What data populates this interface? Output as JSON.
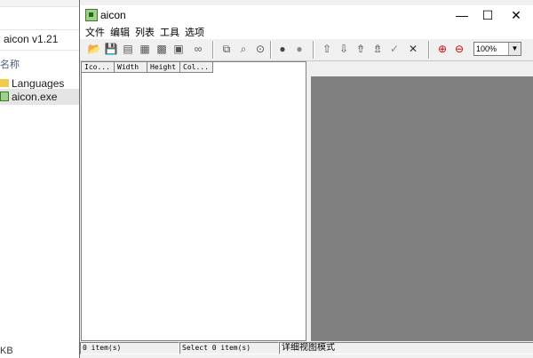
{
  "explorer": {
    "title": "aicon v1.21",
    "column_name": "名称",
    "items": [
      {
        "label": "Languages",
        "icon": "folder-icon"
      },
      {
        "label": "aicon.exe",
        "icon": "exe-icon",
        "selected": true
      }
    ],
    "size_text": "KB"
  },
  "window": {
    "title": "aicon",
    "controls": {
      "minimize": "—",
      "maximize": "☐",
      "close": "✕"
    }
  },
  "menu": {
    "items": [
      "文件",
      "编辑",
      "列表",
      "工具",
      "选项"
    ]
  },
  "toolbar": {
    "zoom": "100%",
    "buttons": [
      {
        "name": "open-icon",
        "glyph": "📂"
      },
      {
        "name": "save-icon",
        "glyph": "💾"
      },
      {
        "name": "save-all-icon",
        "glyph": "▤"
      },
      {
        "name": "export-icon",
        "glyph": "▦"
      },
      {
        "name": "export-all-icon",
        "glyph": "▩"
      },
      {
        "name": "extract-icon",
        "glyph": "▣"
      },
      {
        "name": "link-icon",
        "glyph": "∞"
      },
      {
        "name": "copy-icon",
        "glyph": "⧉"
      },
      {
        "name": "find-icon",
        "glyph": "⌕"
      },
      {
        "name": "search-icon",
        "glyph": "⊙"
      },
      {
        "name": "user-icon",
        "glyph": "●"
      },
      {
        "name": "user-grey-icon",
        "glyph": "●"
      },
      {
        "name": "arrow-up-icon",
        "glyph": "⇧"
      },
      {
        "name": "arrow-down-icon",
        "glyph": "⇩"
      },
      {
        "name": "move-top-icon",
        "glyph": "⇮"
      },
      {
        "name": "move-bottom-icon",
        "glyph": "⇯"
      },
      {
        "name": "check-icon",
        "glyph": "✓"
      },
      {
        "name": "delete-icon",
        "glyph": "✕"
      },
      {
        "name": "zoom-in-icon",
        "glyph": "⊕"
      },
      {
        "name": "zoom-out-icon",
        "glyph": "⊖"
      }
    ]
  },
  "list": {
    "columns": [
      "Ico...",
      "Width",
      "Height",
      "Col..."
    ]
  },
  "status": {
    "items": "0 item(s)",
    "selected": "Select 0 item(s)",
    "mode": "详细视图模式"
  },
  "colors": {
    "preview_bg": "#808080",
    "accent_zoom": "#cc0000"
  }
}
